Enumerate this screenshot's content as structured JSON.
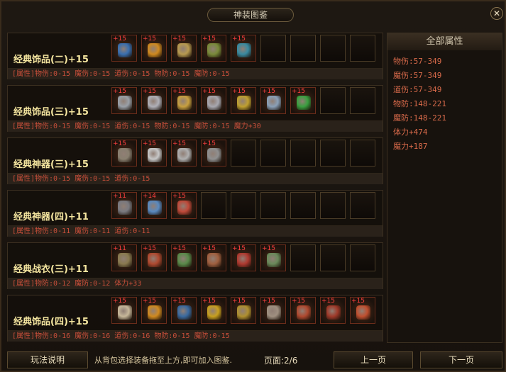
{
  "window": {
    "title": "神装图鉴",
    "close": "✕"
  },
  "rows": [
    {
      "name": "经典饰品(二)+15",
      "attr": "[属性]物伤:0-15 魔伤:0-15 道伤:0-15 物防:0-15 魔防:0-15",
      "items": [
        {
          "plus": "+15",
          "icon": "necklace-icon",
          "color": "#3a6fb0"
        },
        {
          "plus": "+15",
          "icon": "necklace-icon",
          "color": "#d08a20"
        },
        {
          "plus": "+15",
          "icon": "necklace-icon",
          "color": "#b89a50"
        },
        {
          "plus": "+15",
          "icon": "bracelet-icon",
          "color": "#7a8a3a"
        },
        {
          "plus": "+15",
          "icon": "bracelet-icon",
          "color": "#3a8aa0"
        }
      ]
    },
    {
      "name": "经典饰品(三)+15",
      "attr": "[属性]物伤:0-15 魔伤:0-15 道伤:0-15 物防:0-15 魔防:0-15 魔力+30",
      "items": [
        {
          "plus": "+15",
          "icon": "ring-icon",
          "color": "#9aa0a8"
        },
        {
          "plus": "+15",
          "icon": "ring-icon",
          "color": "#b0b0b8"
        },
        {
          "plus": "+15",
          "icon": "ring-icon",
          "color": "#c8a040"
        },
        {
          "plus": "+15",
          "icon": "ring-icon",
          "color": "#a8a8b0"
        },
        {
          "plus": "+15",
          "icon": "ring-icon",
          "color": "#c0a030"
        },
        {
          "plus": "+15",
          "icon": "ring-icon",
          "color": "#8aa0b8"
        },
        {
          "plus": "+15",
          "icon": "gem-icon",
          "color": "#3aa040"
        }
      ]
    },
    {
      "name": "经典神器(三)+15",
      "attr": "[属性]物伤:0-15 魔伤:0-15 道伤:0-15",
      "items": [
        {
          "plus": "+15",
          "icon": "sword-icon",
          "color": "#8a8070"
        },
        {
          "plus": "+15",
          "icon": "sword-icon",
          "color": "#c8c8c8"
        },
        {
          "plus": "+15",
          "icon": "sword-icon",
          "color": "#b0b0b0"
        },
        {
          "plus": "+15",
          "icon": "sword-icon",
          "color": "#909090"
        }
      ]
    },
    {
      "name": "经典神器(四)+11",
      "attr": "[属性]物伤:0-11 魔伤:0-11 道伤:0-11",
      "items": [
        {
          "plus": "+11",
          "icon": "sword-icon",
          "color": "#7a7a80"
        },
        {
          "plus": "+14",
          "icon": "sword-icon",
          "color": "#5a8ac0"
        },
        {
          "plus": "+15",
          "icon": "sword-icon",
          "color": "#c04a3a"
        }
      ]
    },
    {
      "name": "经典战衣(三)+11",
      "attr": "[属性]物防:0-12 魔防:0-12 体力+33",
      "items": [
        {
          "plus": "+11",
          "icon": "armor-icon",
          "color": "#8a7a50"
        },
        {
          "plus": "+15",
          "icon": "armor-icon",
          "color": "#b04a30"
        },
        {
          "plus": "+15",
          "icon": "armor-icon",
          "color": "#5a8a4a"
        },
        {
          "plus": "+15",
          "icon": "armor-icon",
          "color": "#a06040"
        },
        {
          "plus": "+15",
          "icon": "armor-icon",
          "color": "#b03a30"
        },
        {
          "plus": "+15",
          "icon": "armor-icon",
          "color": "#6a8a5a"
        }
      ]
    },
    {
      "name": "经典饰品(四)+15",
      "attr": "[属性]物伤:0-16 魔伤:0-16 道伤:0-16 物防:0-15 魔防:0-15",
      "items": [
        {
          "plus": "+15",
          "icon": "horn-icon",
          "color": "#c8b89a"
        },
        {
          "plus": "+15",
          "icon": "necklace-icon",
          "color": "#d08a20"
        },
        {
          "plus": "+15",
          "icon": "necklace-icon",
          "color": "#3a6aa0"
        },
        {
          "plus": "+15",
          "icon": "belt-icon",
          "color": "#c8a020"
        },
        {
          "plus": "+15",
          "icon": "belt-icon",
          "color": "#b09030"
        },
        {
          "plus": "+15",
          "icon": "glove-icon",
          "color": "#a09080"
        },
        {
          "plus": "+15",
          "icon": "boot-icon",
          "color": "#b04a30"
        },
        {
          "plus": "+15",
          "icon": "boot-icon",
          "color": "#a03a2a"
        },
        {
          "plus": "+15",
          "icon": "helmet-icon",
          "color": "#c05030"
        }
      ]
    }
  ],
  "side": {
    "title": "全部属性",
    "stats": [
      "物伤:57-349",
      "魔伤:57-349",
      "道伤:57-349",
      "物防:148-221",
      "魔防:148-221",
      "体力+474",
      "魔力+187"
    ]
  },
  "footer": {
    "help_label": "玩法说明",
    "hint": "从背包选择装备拖至上方,即可加入图鉴.",
    "page": "页面:2/6",
    "prev_label": "上一页",
    "next_label": "下一页"
  }
}
